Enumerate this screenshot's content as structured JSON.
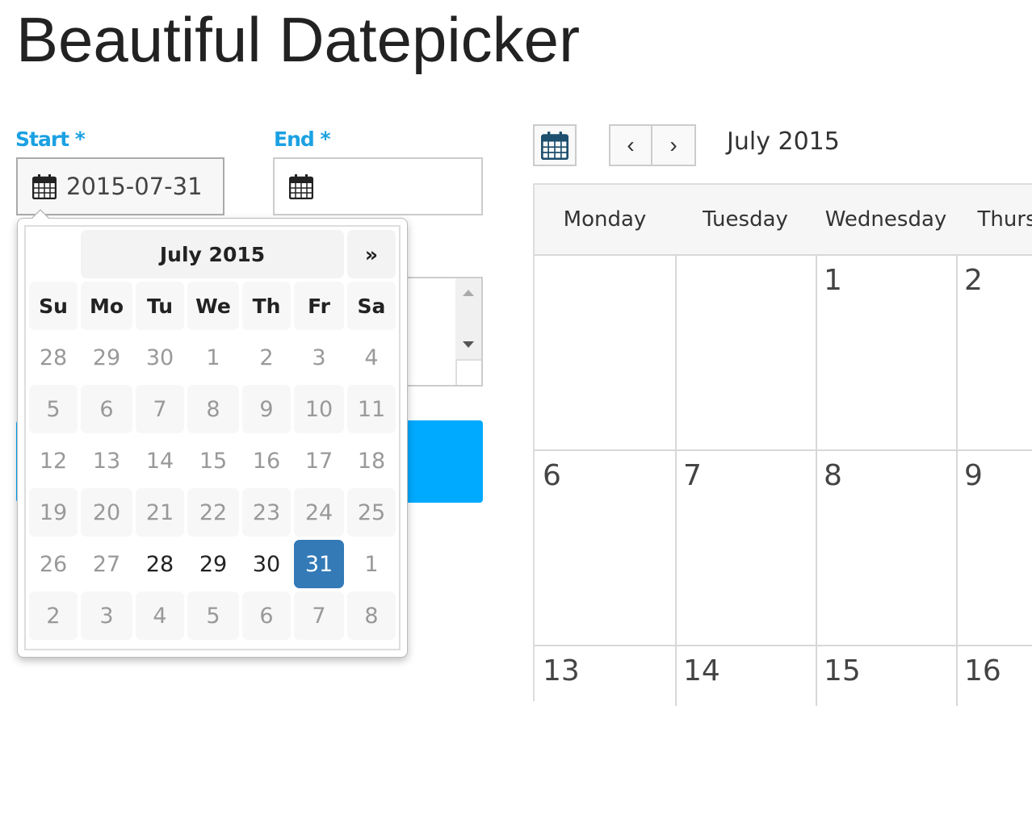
{
  "page": {
    "title": "Beautiful Datepicker"
  },
  "form": {
    "start_label": "Start *",
    "end_label": "End *",
    "start_value": "2015-07-31",
    "end_value": ""
  },
  "datepicker": {
    "month_title": "July 2015",
    "next_label": "»",
    "weekdays": [
      "Su",
      "Mo",
      "Tu",
      "We",
      "Th",
      "Fr",
      "Sa"
    ],
    "weeks": [
      [
        "28",
        "29",
        "30",
        "1",
        "2",
        "3",
        "4"
      ],
      [
        "5",
        "6",
        "7",
        "8",
        "9",
        "10",
        "11"
      ],
      [
        "12",
        "13",
        "14",
        "15",
        "16",
        "17",
        "18"
      ],
      [
        "19",
        "20",
        "21",
        "22",
        "23",
        "24",
        "25"
      ],
      [
        "26",
        "27",
        "28",
        "29",
        "30",
        "31",
        "1"
      ],
      [
        "2",
        "3",
        "4",
        "5",
        "6",
        "7",
        "8"
      ]
    ],
    "selected": "31",
    "enabled_days": [
      "28",
      "29",
      "30",
      "31"
    ]
  },
  "calendar": {
    "prev_label": "‹",
    "next_label": "›",
    "month_title": "July 2015",
    "weekdays": [
      "Monday",
      "Tuesday",
      "Wednesday",
      "Thursday"
    ],
    "weeks": [
      [
        "",
        "",
        "1",
        "2"
      ],
      [
        "6",
        "7",
        "8",
        "9"
      ],
      [
        "13",
        "14",
        "15",
        "16"
      ]
    ]
  },
  "colors": {
    "accent": "#1ba1e2",
    "selected": "#337ab7",
    "button": "#00aaff",
    "calendar_icon": "#1d4f6e"
  }
}
